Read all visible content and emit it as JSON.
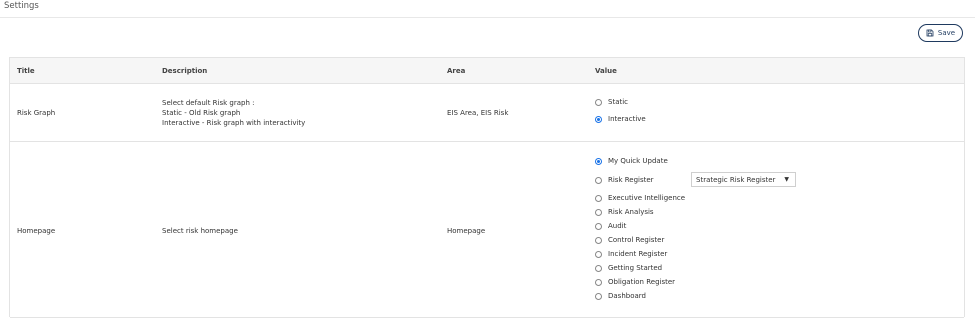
{
  "page": {
    "title": "Settings"
  },
  "toolbar": {
    "save_label": "Save"
  },
  "table": {
    "headers": {
      "title": "Title",
      "description": "Description",
      "area": "Area",
      "value": "Value"
    },
    "rows": [
      {
        "title": "Risk Graph",
        "description": [
          "Select default Risk graph :",
          "Static - Old Risk graph",
          "Interactive - Risk graph with interactivity"
        ],
        "area": "EIS Area, EIS Risk",
        "options": [
          {
            "label": "Static",
            "checked": false
          },
          {
            "label": "Interactive",
            "checked": true
          }
        ]
      },
      {
        "title": "Homepage",
        "description": [
          "Select risk homepage"
        ],
        "area": "Homepage",
        "options": [
          {
            "label": "My Quick Update",
            "checked": true
          },
          {
            "label": "Risk Register",
            "checked": false
          },
          {
            "label": "Executive Intelligence",
            "checked": false
          },
          {
            "label": "Risk Analysis",
            "checked": false
          },
          {
            "label": "Audit",
            "checked": false
          },
          {
            "label": "Control Register",
            "checked": false
          },
          {
            "label": "Incident Register",
            "checked": false
          },
          {
            "label": "Getting Started",
            "checked": false
          },
          {
            "label": "Obligation Register",
            "checked": false
          },
          {
            "label": "Dashboard",
            "checked": false
          }
        ],
        "register_select": {
          "value": "Strategic Risk Register"
        }
      }
    ]
  },
  "colors": {
    "accent": "#1a73e8",
    "save_border": "#1f3a5f",
    "header_bg": "#f6f6f6",
    "border": "#e3e3e3"
  }
}
